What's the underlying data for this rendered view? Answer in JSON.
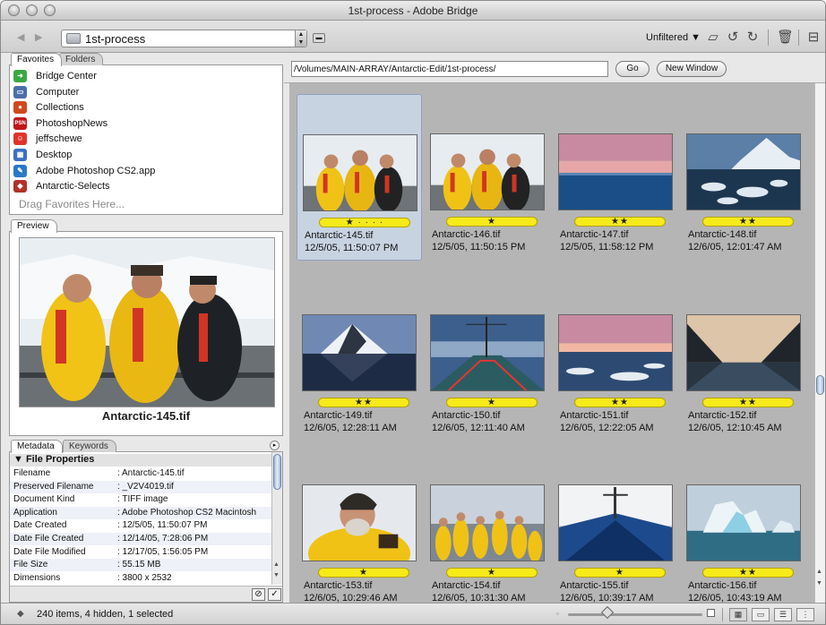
{
  "window": {
    "title": "1st-process - Adobe Bridge"
  },
  "toolbar": {
    "back_icon": "back-arrow-icon",
    "forward_icon": "forward-arrow-icon",
    "folder": "1st-process",
    "filter": "Unfiltered",
    "filter_arrow": "▼"
  },
  "favorites": {
    "tab_favorites": "Favorites",
    "tab_folders": "Folders",
    "items": [
      {
        "label": "Bridge Center",
        "icon_text": "➜",
        "color": "#3aa840"
      },
      {
        "label": "Computer",
        "icon_text": "▭",
        "color": "#4a6fa8"
      },
      {
        "label": "Collections",
        "icon_text": "●",
        "color": "#d0491e"
      },
      {
        "label": "PhotoshopNews",
        "icon_text": "PSN",
        "color": "#c01818"
      },
      {
        "label": "jeffschewe",
        "icon_text": "☺",
        "color": "#e0342b"
      },
      {
        "label": "Desktop",
        "icon_text": "▦",
        "color": "#3b6fc2"
      },
      {
        "label": "Adobe Photoshop CS2.app",
        "icon_text": "✎",
        "color": "#2a79c7"
      },
      {
        "label": "Antarctic-Selects",
        "icon_text": "◆",
        "color": "#b2312a"
      }
    ],
    "drag_hint": "Drag Favorites Here..."
  },
  "preview": {
    "tab": "Preview",
    "filename": "Antarctic-145.tif"
  },
  "metadata": {
    "tab_metadata": "Metadata",
    "tab_keywords": "Keywords",
    "section": "File Properties",
    "rows": [
      {
        "k": "Filename",
        "v": ": Antarctic-145.tif"
      },
      {
        "k": "Preserved Filename",
        "v": ": _V2V4019.tif"
      },
      {
        "k": "Document Kind",
        "v": ": TIFF image"
      },
      {
        "k": "Application",
        "v": ": Adobe Photoshop CS2 Macintosh"
      },
      {
        "k": "Date Created",
        "v": ": 12/5/05, 11:50:07 PM"
      },
      {
        "k": "Date File Created",
        "v": ": 12/14/05, 7:28:06 PM"
      },
      {
        "k": "Date File Modified",
        "v": ": 12/17/05, 1:56:05 PM"
      },
      {
        "k": "File Size",
        "v": ": 55.15 MB"
      },
      {
        "k": "Dimensions",
        "v": ": 3800 x 2532"
      }
    ]
  },
  "address": {
    "path": "/Volumes/MAIN-ARRAY/Antarctic-Edit/1st-process/",
    "go": "Go",
    "new_window": "New Window"
  },
  "thumbnails": [
    {
      "name": "Antarctic-145.tif",
      "date": "12/5/05, 11:50:07 PM",
      "stars": "★ · · · ·",
      "rating": 1,
      "selected": true,
      "scene": "people"
    },
    {
      "name": "Antarctic-146.tif",
      "date": "12/5/05, 11:50:15 PM",
      "stars": "★",
      "rating": 1,
      "selected": false,
      "scene": "people"
    },
    {
      "name": "Antarctic-147.tif",
      "date": "12/5/05, 11:58:12 PM",
      "stars": "★★",
      "rating": 2,
      "selected": false,
      "scene": "dusk"
    },
    {
      "name": "Antarctic-148.tif",
      "date": "12/6/05, 12:01:47 AM",
      "stars": "★★",
      "rating": 2,
      "selected": false,
      "scene": "ice"
    },
    {
      "name": "Antarctic-149.tif",
      "date": "12/6/05, 12:28:11 AM",
      "stars": "★★",
      "rating": 2,
      "selected": false,
      "scene": "mountain"
    },
    {
      "name": "Antarctic-150.tif",
      "date": "12/6/05, 12:11:40 AM",
      "stars": "★",
      "rating": 1,
      "selected": false,
      "scene": "deck"
    },
    {
      "name": "Antarctic-151.tif",
      "date": "12/6/05, 12:22:05 AM",
      "stars": "★★",
      "rating": 2,
      "selected": false,
      "scene": "dusk2"
    },
    {
      "name": "Antarctic-152.tif",
      "date": "12/6/05, 12:10:45 AM",
      "stars": "★★",
      "rating": 2,
      "selected": false,
      "scene": "fjord"
    },
    {
      "name": "Antarctic-153.tif",
      "date": "12/6/05, 10:29:46 AM",
      "stars": "★",
      "rating": 1,
      "selected": false,
      "scene": "portrait"
    },
    {
      "name": "Antarctic-154.tif",
      "date": "12/6/05, 10:31:30 AM",
      "stars": "★",
      "rating": 1,
      "selected": false,
      "scene": "crowd"
    },
    {
      "name": "Antarctic-155.tif",
      "date": "12/6/05, 10:39:17 AM",
      "stars": "★",
      "rating": 1,
      "selected": false,
      "scene": "bow"
    },
    {
      "name": "Antarctic-156.tif",
      "date": "12/6/05, 10:43:19 AM",
      "stars": "★★",
      "rating": 2,
      "selected": false,
      "scene": "iceberg"
    }
  ],
  "status": {
    "text": "240 items, 4 hidden, 1 selected"
  }
}
